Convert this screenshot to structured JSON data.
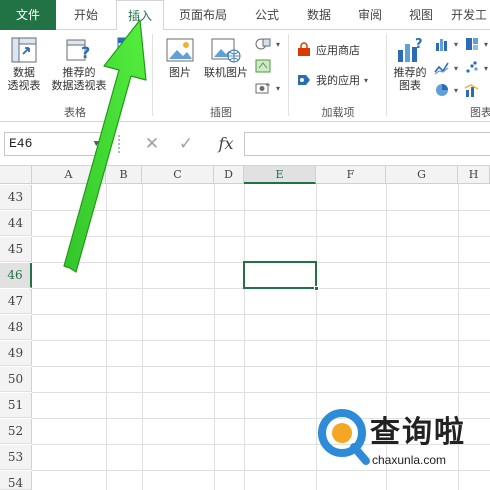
{
  "tabs": [
    {
      "label": "文件",
      "state": "file"
    },
    {
      "label": "开始",
      "state": "normal"
    },
    {
      "label": "插入",
      "state": "active"
    },
    {
      "label": "页面布局",
      "state": "normal"
    },
    {
      "label": "公式",
      "state": "normal"
    },
    {
      "label": "数据",
      "state": "normal"
    },
    {
      "label": "审阅",
      "state": "normal"
    },
    {
      "label": "视图",
      "state": "normal"
    },
    {
      "label": "开发工",
      "state": "normal"
    }
  ],
  "ribbon": {
    "tables_group": {
      "label": "表格",
      "pivot_table": {
        "line1": "数据",
        "line2": "透视表"
      },
      "recommended_pivot": {
        "line1": "推荐的",
        "line2": "数据透视表"
      }
    },
    "illustrations_group": {
      "label": "插图",
      "pictures": "图片",
      "online_pictures": "联机图片"
    },
    "addins_group": {
      "label": "加载项",
      "app_store": "应用商店",
      "my_apps": "我的应用"
    },
    "charts_group": {
      "label": "图表",
      "recommended_charts": {
        "line1": "推荐的",
        "line2": "图表"
      }
    }
  },
  "formula_bar": {
    "name_box": "E46",
    "fx_label": "fx",
    "formula": ""
  },
  "grid": {
    "columns": [
      "A",
      "B",
      "C",
      "D",
      "E",
      "F",
      "G",
      "H"
    ],
    "selected_column": "E",
    "rows": [
      "43",
      "44",
      "45",
      "46",
      "47",
      "48",
      "49",
      "50",
      "51",
      "52",
      "53",
      "54"
    ],
    "selected_row": "46",
    "active_cell": "E46"
  },
  "watermark": {
    "title": "查询啦",
    "subtitle": "chaxunla.com"
  },
  "colors": {
    "excel_green": "#217346",
    "arrow_green": "#3ddc2f",
    "watermark_blue": "#2e8bd8"
  }
}
